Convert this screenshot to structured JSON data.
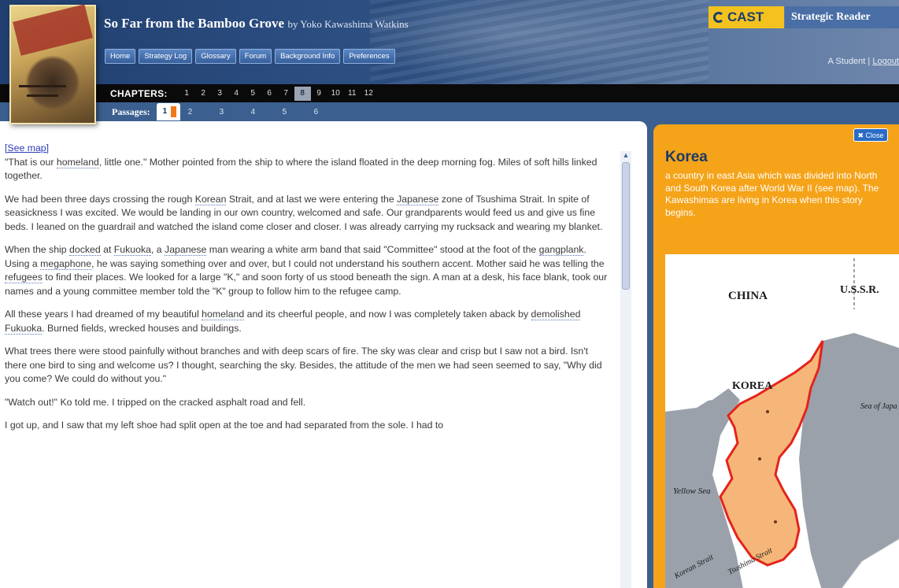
{
  "header": {
    "book_title": "So Far from the Bamboo Grove",
    "byline": "by Yoko Kawashima Watkins",
    "nav": [
      "Home",
      "Strategy Log",
      "Glossary",
      "Forum",
      "Background Info",
      "Preferences"
    ],
    "brand": "CAST",
    "app_name": "Strategic Reader",
    "user_name": "A Student",
    "separator": "|",
    "logout": "Logout"
  },
  "chapters": {
    "label": "CHAPTERS:",
    "items": [
      "1",
      "2",
      "3",
      "4",
      "5",
      "6",
      "7",
      "8",
      "9",
      "10",
      "11",
      "12"
    ],
    "active": "8"
  },
  "passages": {
    "label": "Passages:",
    "items": [
      "1",
      "2",
      "3",
      "4",
      "5",
      "6"
    ],
    "active": "1"
  },
  "reader": {
    "see_map": "[See map]",
    "p1": [
      "\"That is our ",
      "homeland",
      ", little one.\" Mother pointed from the ship to where the island floated in the deep morning fog. Miles of soft hills linked together."
    ],
    "p2": [
      "We had been three days crossing the rough ",
      "Korean",
      " Strait, and at last we were entering the ",
      "Japanese",
      " zone of Tsushima Strait. In spite of seasickness I was excited. We would be landing in our own country, welcomed and safe. Our grandparents would feed us and give us fine beds. I leaned on the guardrail and watched the island come closer and closer. I was already carrying my rucksack and wearing my blanket."
    ],
    "p3": [
      "When the ship ",
      "docked",
      " at ",
      "Fukuoka",
      ", a ",
      "Japanese",
      " man wearing a white arm band that said \"Committee\" stood at the foot of the ",
      "gangplank",
      ". Using a ",
      "megaphone",
      ", he was saying something over and over, but I could not understand his southern accent. Mother said he was telling the ",
      "refugees",
      " to find their places. We looked for a large \"K,\" and soon forty of us stood beneath the sign. A man at a desk, his face blank, took our names and a young committee member told the \"K\" group to follow him to the refugee camp."
    ],
    "p4": [
      "All these years I had dreamed of my beautiful ",
      "homeland",
      " and its cheerful people, and now I was completely taken aback by ",
      "demolished",
      " ",
      "Fukuoka",
      ". Burned fields, wrecked houses and buildings."
    ],
    "p5": "What trees there were stood painfully without branches and with deep scars of fire. The sky was clear and crisp but I saw not a bird. Isn't there one bird to sing and welcome us? I thought, searching the sky. Besides, the attitude of the men we had seen seemed to say, \"Why did you come? We could do without you.\"",
    "p6": "\"Watch out!\" Ko told me. I tripped on the cracked asphalt road and fell.",
    "p7": "I got up, and I saw that my left shoe had split open at the toe and had separated from the sole. I had to"
  },
  "glossary": {
    "close": "✖ Close",
    "term": "Korea",
    "definition": "a country in east Asia which was divided into North and South Korea after World War II (see map). The Kawashimas are living in Korea when this story begins.",
    "map_labels": {
      "china": "CHINA",
      "ussr": "U.S.S.R.",
      "korea": "KOREA",
      "sea_of_japan": "Sea of Japa",
      "yellow_sea": "Yellow Sea",
      "korean_strait": "Korean Strait",
      "tsushima_strait": "Tsushima Strait"
    }
  },
  "colors": {
    "header_dark": "#213f70",
    "accent_orange": "#f5a319",
    "cast_yellow": "#f4c21e",
    "korea_fill": "#f6b679",
    "korea_border": "#e3241b",
    "link_blue": "#2b3db5"
  }
}
